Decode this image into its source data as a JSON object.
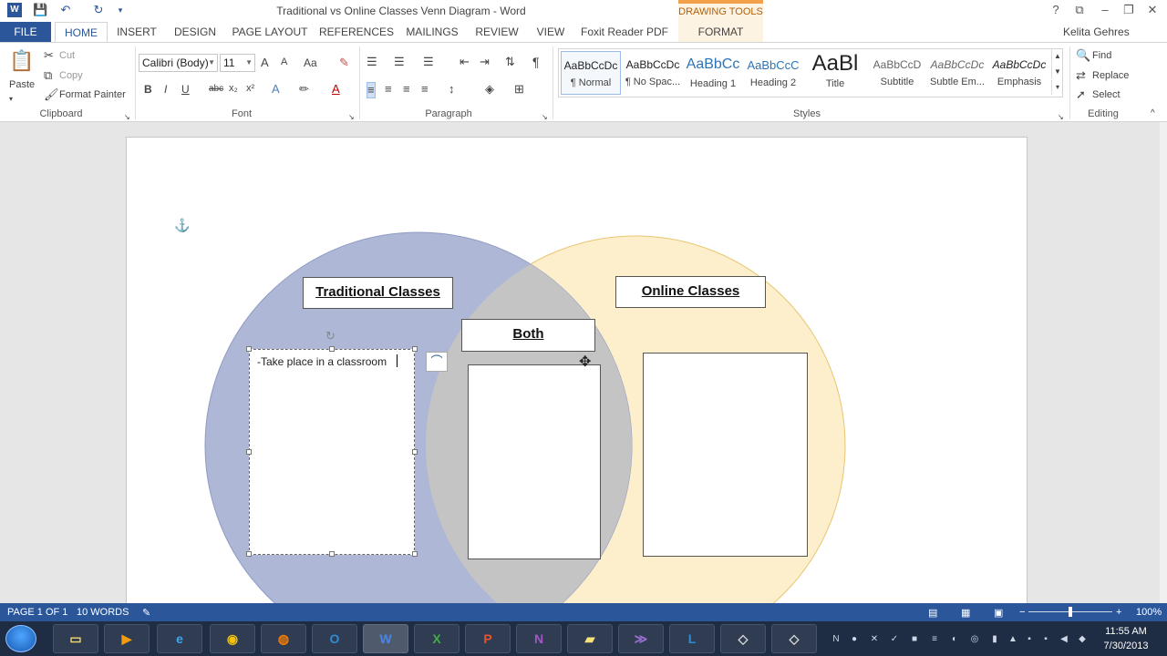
{
  "window": {
    "title": "Traditional vs Online Classes Venn Diagram - Word",
    "contextual_tab_header": "DRAWING TOOLS",
    "user_name": "Kelita Gehres",
    "help_glyph": "?"
  },
  "tabs": [
    "FILE",
    "HOME",
    "INSERT",
    "DESIGN",
    "PAGE LAYOUT",
    "REFERENCES",
    "MAILINGS",
    "REVIEW",
    "VIEW",
    "Foxit Reader PDF",
    "FORMAT"
  ],
  "active_tab": "HOME",
  "ribbon": {
    "clipboard": {
      "label": "Clipboard",
      "paste": "Paste",
      "cut": "Cut",
      "copy": "Copy",
      "format_painter": "Format Painter"
    },
    "font": {
      "label": "Font",
      "font_name": "Calibri (Body)",
      "font_size": "11",
      "bold": "B",
      "italic": "I",
      "underline": "U",
      "strikethrough": "abc",
      "subscript": "x₂",
      "superscript": "x²",
      "grow": "A",
      "shrink": "A",
      "change_case": "Aa",
      "font_color": "A"
    },
    "paragraph": {
      "label": "Paragraph",
      "pilcrow": "¶"
    },
    "styles": {
      "label": "Styles",
      "items": [
        {
          "sample": "AaBbCcDc",
          "name": "¶ Normal"
        },
        {
          "sample": "AaBbCcDc",
          "name": "¶ No Spac..."
        },
        {
          "sample": "AaBbCc",
          "name": "Heading 1"
        },
        {
          "sample": "AaBbCcC",
          "name": "Heading 2"
        },
        {
          "sample": "AaBl",
          "name": "Title"
        },
        {
          "sample": "AaBbCcD",
          "name": "Subtitle"
        },
        {
          "sample": "AaBbCcDc",
          "name": "Subtle Em..."
        },
        {
          "sample": "AaBbCcDc",
          "name": "Emphasis"
        }
      ]
    },
    "editing": {
      "label": "Editing",
      "find": "Find",
      "replace": "Replace",
      "select": "Select"
    }
  },
  "document": {
    "venn": {
      "left_title": "Traditional Classes",
      "right_title": "Online Classes",
      "middle_title": "Both",
      "left_text": "-Take place in a classroom",
      "colors": {
        "left_circle": "#aeb7d6",
        "right_circle": "#fdefcc",
        "overlap": "#c4c4c4"
      }
    }
  },
  "statusbar": {
    "page": "PAGE 1 OF 1",
    "words": "10 WORDS",
    "zoom": "100%"
  },
  "taskbar": {
    "apps": [
      "explorer",
      "media",
      "ie",
      "chrome",
      "firefox",
      "outlook",
      "word",
      "excel",
      "powerpoint",
      "onenote",
      "sticky-notes",
      "vs",
      "lync",
      "app-13",
      "app-14"
    ],
    "clock_time": "11:55 AM",
    "clock_date": "7/30/2013"
  }
}
